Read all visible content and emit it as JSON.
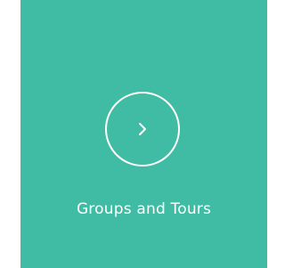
{
  "tile": {
    "label": "Groups and Tours",
    "background_color": "#40bca4",
    "foreground_color": "#ffffff",
    "icon": "chevron-right-icon"
  }
}
